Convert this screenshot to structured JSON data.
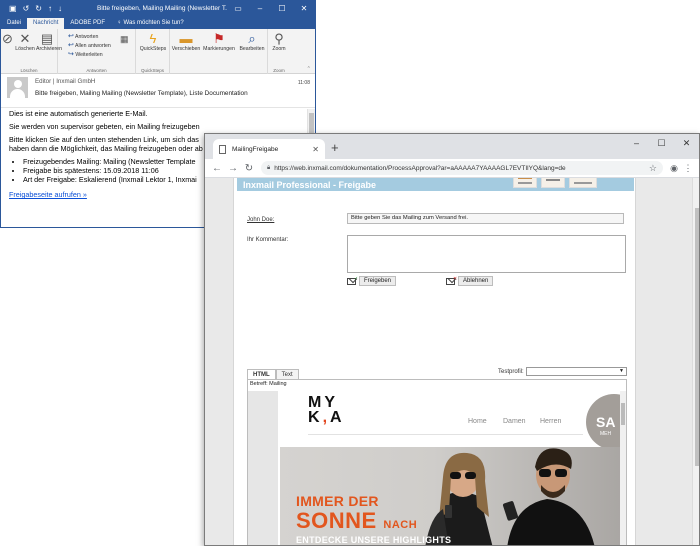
{
  "outlook": {
    "title": "Bitte freigeben, Mailing Mailing (Newsletter T...",
    "tabs": [
      "Datei",
      "Nachricht",
      "ADOBE PDF"
    ],
    "tell_me": "Was möchten Sie tun?",
    "ribbon": {
      "delete_label": "Löschen",
      "archive_label": "Archivieren",
      "reply_label": "Antworten",
      "reply_all_label": "Allen antworten",
      "forward_label": "Weiterleiten",
      "quicksteps_label": "QuickSteps",
      "move_label": "Verschieben",
      "tags_label": "Markierungen",
      "edit_label": "Bearbeiten",
      "zoom_label": "Zoom",
      "group_delete": "Löschen",
      "group_respond": "Antworten",
      "group_quicksteps": "QuickSteps",
      "group_zoom": "Zoom"
    },
    "header": {
      "from": "Editor | Inxmail GmbH",
      "time": "11:08",
      "subject": "Bitte freigeben, Mailing Mailing (Newsletter Template), Liste Documentation"
    },
    "body": {
      "line1": "Dies ist eine automatisch generierte E-Mail.",
      "line2": "Sie werden von supervisor gebeten, ein Mailing freizugeben",
      "line3": "Bitte klicken Sie auf den unten stehenden Link, um sich das",
      "line4": "haben dann die Möglichkeit, das Mailing freizugeben oder ab",
      "bullets": [
        "Freizugebendes Mailing: Mailing (Newsletter Template",
        "Freigabe bis spätestens: 15.09.2018 11:06",
        "Art der Freigabe: Eskalierend (Inxmail Lektor 1, Inxmai"
      ],
      "link": "Freigabeseite aufrufen »"
    }
  },
  "chrome": {
    "tab_title": "MailingFreigabe",
    "url": "https://web.inxmail.com/dokumentation/ProcessApproval?ar=aAAAAA7YAAAAGL7EVTIlYQ&lang=de"
  },
  "page": {
    "banner_title": "Inxmail Professional - Freigabe",
    "user_label": "John Doe:",
    "user_message": "Bitte geben Sie das Mailing zum Versand frei.",
    "comment_label": "Ihr Kommentar:",
    "approve_label": "Freigeben",
    "reject_label": "Ablehnen",
    "tab_html": "HTML",
    "tab_text": "Text",
    "testprofil_label": "Testprofil:",
    "subject_line": "Betreff: Mailing"
  },
  "email": {
    "logo_top": "MY",
    "logo_bottom_k": "K",
    "logo_comma": ",",
    "logo_bottom_a": "A",
    "nav": [
      "Home",
      "Damen",
      "Herren"
    ],
    "sale": "SA",
    "sale_sub": "MEH",
    "hero_line1": "IMMER DER",
    "hero_line2": "SONNE",
    "hero_line2b": "NACH",
    "hero_line3": "ENTDECKE UNSERE HIGHLIGHTS"
  },
  "colors": {
    "outlook_blue": "#2b579a",
    "banner_blue": "#a4cbe0",
    "hero_orange": "#e2561e",
    "link_blue": "#0b4fd6"
  }
}
